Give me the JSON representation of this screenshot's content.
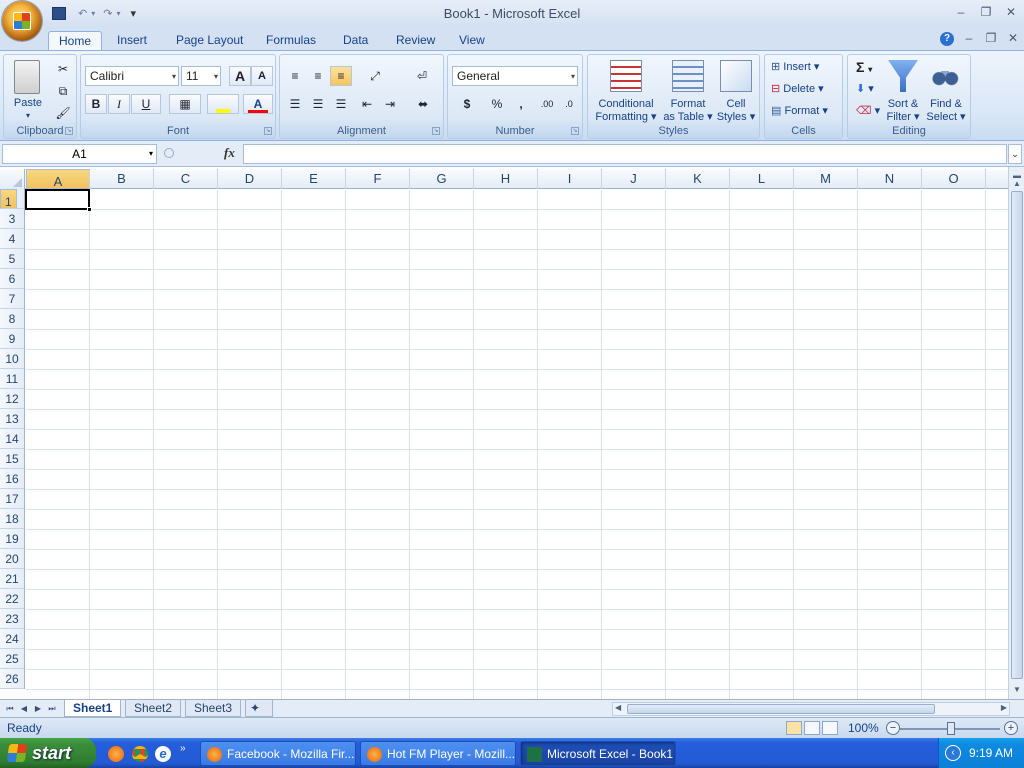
{
  "window": {
    "title": "Book1 - Microsoft Excel",
    "controls": {
      "minimize": "–",
      "restore": "❐",
      "close": "✕"
    }
  },
  "quick_access": {
    "save": "save-icon",
    "undo": "undo-icon",
    "redo": "redo-icon",
    "customize": "▾"
  },
  "tabs": [
    {
      "label": "Home",
      "active": true
    },
    {
      "label": "Insert"
    },
    {
      "label": "Page Layout"
    },
    {
      "label": "Formulas"
    },
    {
      "label": "Data"
    },
    {
      "label": "Review"
    },
    {
      "label": "View"
    }
  ],
  "ribbon": {
    "clipboard": {
      "name": "Clipboard",
      "paste": "Paste"
    },
    "font": {
      "name": "Font",
      "family": "Calibri",
      "size": "11",
      "bold": "B",
      "italic": "I",
      "underline": "U",
      "grow": "A",
      "shrink": "A",
      "fill_color": "#ffff00",
      "font_color": "#ff0000"
    },
    "alignment": {
      "name": "Alignment"
    },
    "number": {
      "name": "Number",
      "format": "General",
      "currency": "$",
      "percent": "%",
      "comma": ",",
      "inc_decimal": ".00",
      "dec_decimal": ".0"
    },
    "styles": {
      "name": "Styles",
      "conditional": [
        "Conditional",
        "Formatting"
      ],
      "format_table": [
        "Format",
        "as Table"
      ],
      "cell_styles": [
        "Cell",
        "Styles"
      ]
    },
    "cells": {
      "name": "Cells",
      "insert": "Insert",
      "delete": "Delete",
      "format": "Format"
    },
    "editing": {
      "name": "Editing",
      "autosum": "Σ",
      "sort": [
        "Sort &",
        "Filter"
      ],
      "find": [
        "Find &",
        "Select"
      ]
    }
  },
  "formula_bar": {
    "name_box": "A1",
    "fx": "fx",
    "value": ""
  },
  "grid": {
    "columns": [
      "A",
      "B",
      "C",
      "D",
      "E",
      "F",
      "G",
      "H",
      "I",
      "J",
      "K",
      "L",
      "M",
      "N",
      "O"
    ],
    "rows": [
      "1",
      "2",
      "3",
      "4",
      "5",
      "6",
      "7",
      "8",
      "9",
      "10",
      "11",
      "12",
      "13",
      "14",
      "15",
      "16",
      "17",
      "18",
      "19",
      "20",
      "21",
      "22",
      "23",
      "24",
      "25",
      "26"
    ],
    "active_cell": "A1"
  },
  "sheets": [
    {
      "label": "Sheet1",
      "active": true
    },
    {
      "label": "Sheet2"
    },
    {
      "label": "Sheet3"
    }
  ],
  "status": {
    "ready": "Ready",
    "zoom": "100%"
  },
  "taskbar": {
    "start": "start",
    "tasks": [
      {
        "label": "Facebook - Mozilla Fir..."
      },
      {
        "label": "Hot FM Player - Mozill..."
      },
      {
        "label": "Microsoft Excel - Book1",
        "active": true
      }
    ],
    "clock": "9:19 AM"
  }
}
